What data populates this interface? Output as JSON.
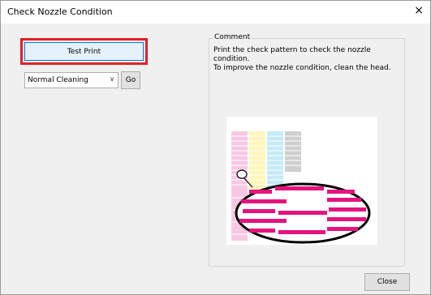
{
  "window": {
    "title": "Check Nozzle Condition",
    "close_glyph": "×"
  },
  "left_panel": {
    "test_print_label": "Test Print",
    "cleaning_select_value": "Normal Cleaning",
    "go_label": "Go",
    "highlight_color": "#e01f2a"
  },
  "comment": {
    "legend": "Comment",
    "lines": [
      "Print the check pattern to check the nozzle condition.",
      "To improve the nozzle condition, clean the head."
    ]
  },
  "illustration": {
    "icons": [
      "nozzle-check-pattern-illustration",
      "magnifier-ellipse"
    ],
    "colors": {
      "magenta": "#e4137e",
      "yellow": "#fff28a",
      "cyan": "#9fdcf0",
      "black": "#8c8c8c"
    }
  },
  "footer": {
    "close_label": "Close"
  }
}
